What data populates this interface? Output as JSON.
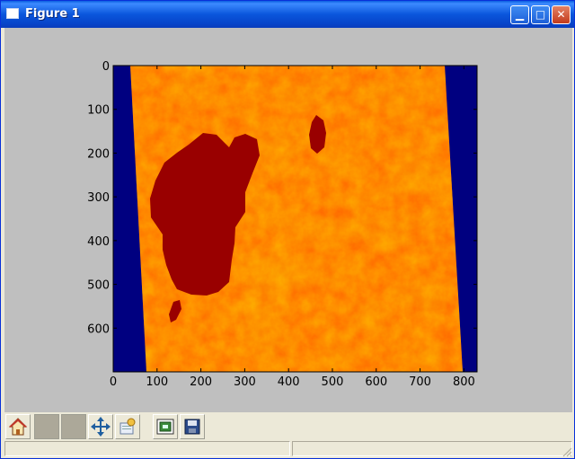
{
  "window": {
    "title": "Figure 1"
  },
  "title_buttons": {
    "minimize": "▁",
    "maximize": "□",
    "close": "✕"
  },
  "toolbar": {
    "buttons": [
      {
        "name": "home",
        "icon": "home-icon"
      },
      {
        "name": "back",
        "icon": "back-icon",
        "disabled": true
      },
      {
        "name": "forward",
        "icon": "forward-icon",
        "disabled": true
      },
      {
        "name": "pan",
        "icon": "pan-icon"
      },
      {
        "name": "zoom",
        "icon": "zoom-icon"
      },
      {
        "name": "configure-subplots",
        "icon": "subplots-icon"
      },
      {
        "name": "save",
        "icon": "save-icon"
      }
    ]
  },
  "status": {
    "message": "",
    "coordinates": ""
  },
  "chart_data": {
    "type": "heatmap",
    "title": "",
    "xlabel": "",
    "ylabel": "",
    "x_ticks": [
      0,
      100,
      200,
      300,
      400,
      500,
      600,
      700,
      800
    ],
    "y_ticks": [
      0,
      100,
      200,
      300,
      400,
      500,
      600
    ],
    "xlim": [
      0,
      830
    ],
    "ylim": [
      700,
      0
    ],
    "colormap": "hot",
    "background_color": "#000080",
    "colors": {
      "nodata": "#000080",
      "lake": "#990000",
      "land": "#ff6a00",
      "land_light": "#ffb000",
      "land_dark": "#e43a00"
    }
  }
}
